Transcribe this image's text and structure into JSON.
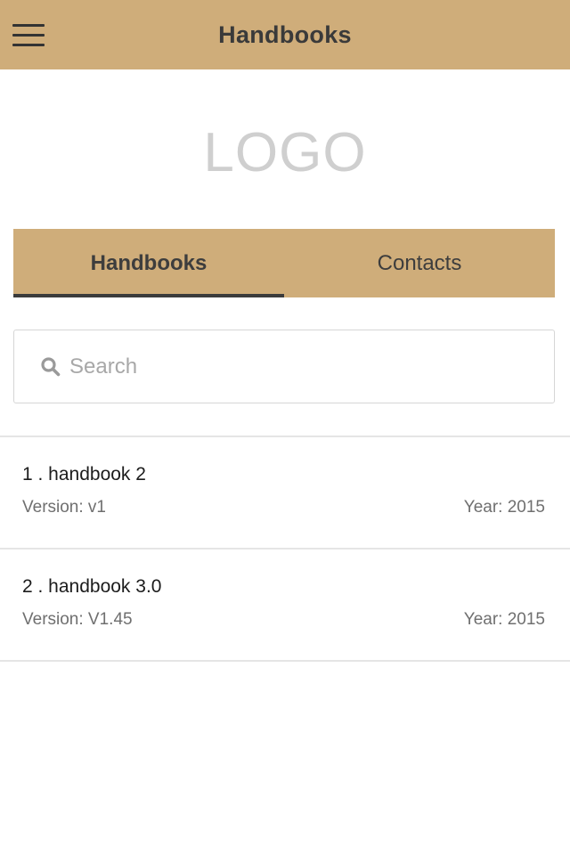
{
  "header": {
    "title": "Handbooks",
    "menu_icon": "hamburger-menu-icon"
  },
  "logo": {
    "text": "LOGO"
  },
  "tabs": [
    {
      "label": "Handbooks",
      "active": true
    },
    {
      "label": "Contacts",
      "active": false
    }
  ],
  "search": {
    "placeholder": "Search",
    "value": "",
    "icon": "search-icon"
  },
  "handbooks": [
    {
      "title": "1 . handbook 2",
      "version": "Version: v1",
      "year": "Year: 2015"
    },
    {
      "title": "2 . handbook 3.0",
      "version": "Version: V1.45",
      "year": "Year: 2015"
    }
  ],
  "colors": {
    "accent": "#cfad7a",
    "active_tab_indicator": "#3b3b3b"
  }
}
